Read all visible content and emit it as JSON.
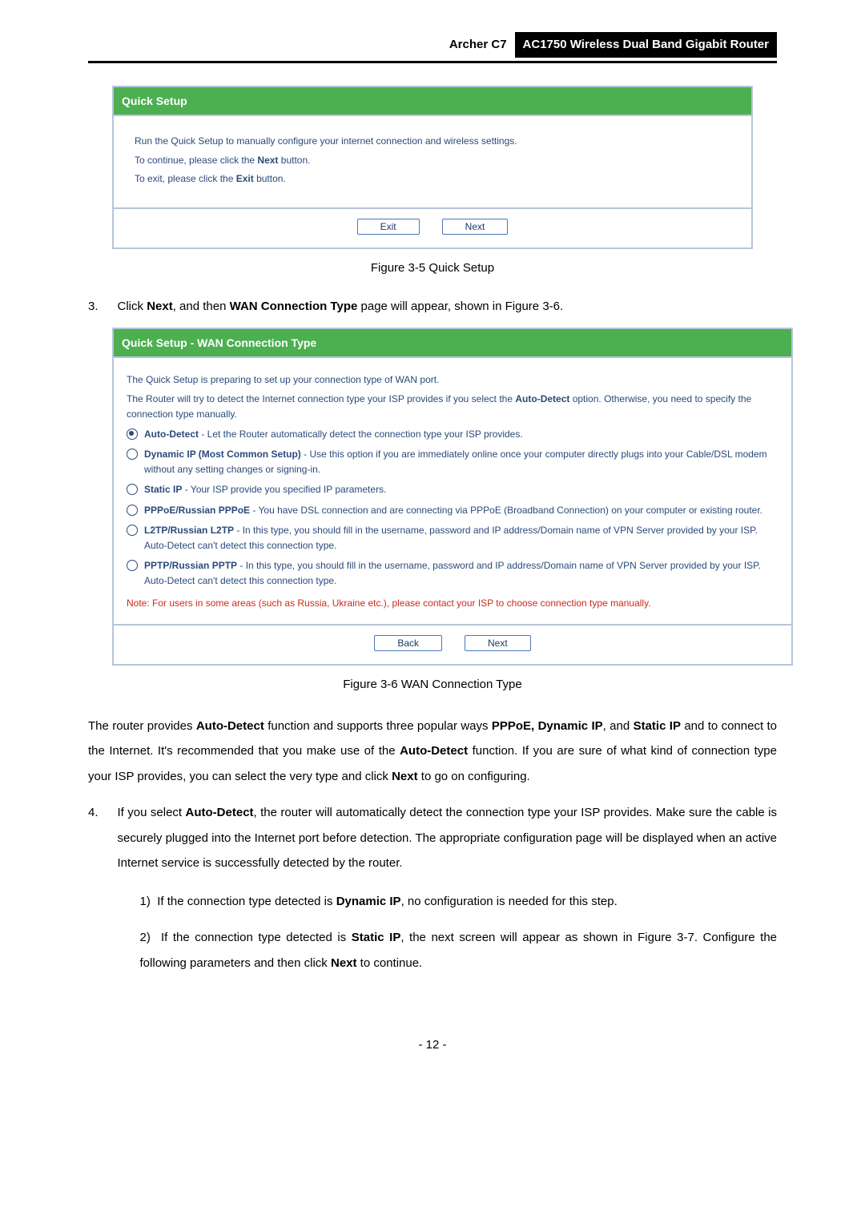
{
  "header": {
    "left": "Archer C7",
    "right": "AC1750 Wireless Dual Band Gigabit Router"
  },
  "panel1": {
    "title": "Quick Setup",
    "line1": "Run the Quick Setup to manually configure your internet connection and wireless settings.",
    "line2_pre": "To continue, please click the ",
    "line2_b": "Next",
    "line2_post": " button.",
    "line3_pre": "To exit, please click the ",
    "line3_b": "Exit",
    "line3_post": " button.",
    "btn_exit": "Exit",
    "btn_next": "Next"
  },
  "fig1": "Figure 3-5 Quick Setup",
  "step3": {
    "marker": "3.",
    "pre": "Click ",
    "b1": "Next",
    "mid": ", and then ",
    "b2": "WAN Connection Type",
    "post": " page will appear, shown in Figure 3-6."
  },
  "panel2": {
    "title": "Quick Setup - WAN Connection Type",
    "line1": "The Quick Setup is preparing to set up your connection type of WAN port.",
    "line2_pre": "The Router will try to detect the Internet connection type your ISP provides if you select the ",
    "line2_b": "Auto-Detect",
    "line2_post": " option. Otherwise, you need to specify the connection type manually.",
    "opt1_b": "Auto-Detect",
    "opt1_rest": " - Let the Router automatically detect the connection type your ISP provides.",
    "opt2_b": "Dynamic IP (Most Common Setup)",
    "opt2_rest": " - Use this option if you are immediately online once your computer directly plugs into your Cable/DSL modem without any setting changes or signing-in.",
    "opt3_b": "Static IP",
    "opt3_rest": " - Your ISP provide you specified IP parameters.",
    "opt4_b": "PPPoE/Russian PPPoE",
    "opt4_rest": " - You have DSL connection and are connecting via PPPoE (Broadband Connection) on your computer or existing router.",
    "opt5_b": "L2TP/Russian L2TP",
    "opt5_rest": " - In this type, you should fill in the username, password and IP address/Domain name of VPN Server provided by your ISP. Auto-Detect can't detect this connection type.",
    "opt6_b": "PPTP/Russian PPTP",
    "opt6_rest": " - In this type, you should fill in the username, password and IP address/Domain name of VPN Server provided by your ISP. Auto-Detect can't detect this connection type.",
    "note": "Note: For users in some areas (such as Russia, Ukraine etc.), please contact your ISP to choose connection type manually.",
    "btn_back": "Back",
    "btn_next": "Next"
  },
  "fig2": "Figure 3-6 WAN Connection Type",
  "para1": {
    "t1": "The router provides ",
    "b1": "Auto-Detect",
    "t2": " function and supports three popular ways ",
    "b2": "PPPoE, Dynamic IP",
    "t3": ", and ",
    "b3": "Static IP",
    "t4": " and to connect to the Internet. It's recommended that you make use of the ",
    "b4": "Auto-Detect",
    "t5": " function. If you are sure of what kind of connection type your ISP provides, you can select the very type and click ",
    "b5": "Next",
    "t6": " to go on configuring."
  },
  "step4": {
    "marker": "4.",
    "t1": "If you select ",
    "b1": "Auto-Detect",
    "t2": ", the router will automatically detect the connection type your ISP provides. Make sure the cable is securely plugged into the Internet port before detection. The appropriate configuration page will be displayed when an active Internet service is successfully detected by the router."
  },
  "sub1": {
    "marker": "1)",
    "t1": "If the connection type detected is ",
    "b1": "Dynamic IP",
    "t2": ", no configuration is needed for this step."
  },
  "sub2": {
    "marker": "2)",
    "t1": "If the connection type detected is ",
    "b1": "Static IP",
    "t2": ", the next screen will appear as shown in Figure 3-7. Configure the following parameters and then click ",
    "b2": "Next",
    "t3": " to continue."
  },
  "page_num": "- 12 -"
}
